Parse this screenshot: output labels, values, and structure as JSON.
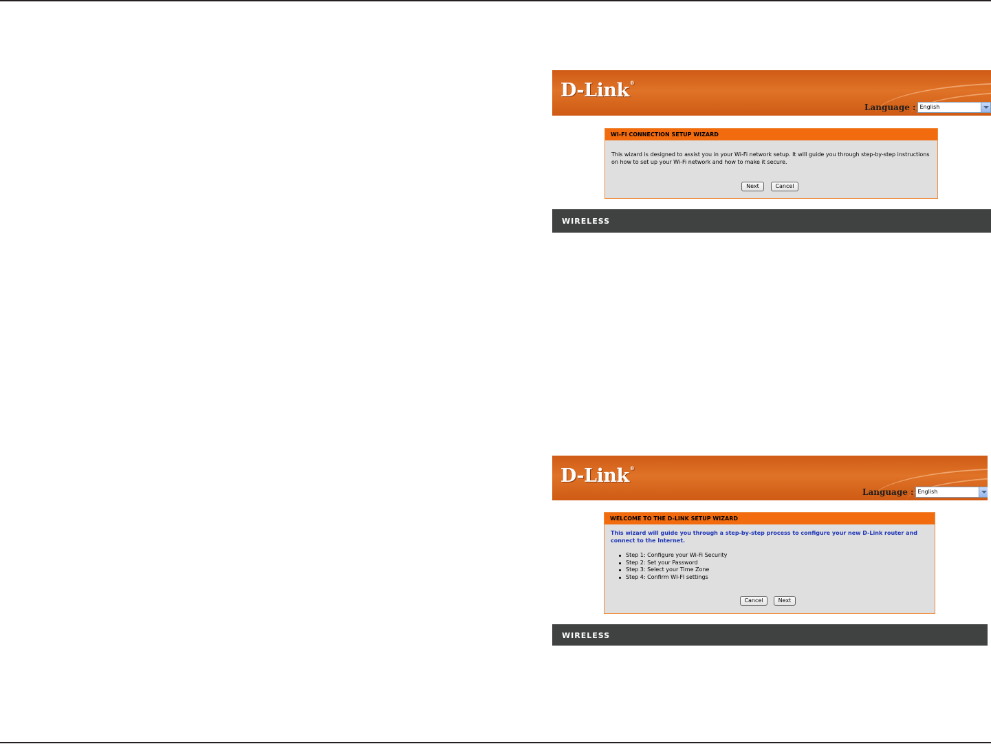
{
  "screenshots": [
    {
      "logo": "D-Link",
      "language_label": "Language :",
      "language_value": "English",
      "panel_title": "WI-FI CONNECTION SETUP WIZARD",
      "body_lines": [
        "This wizard is designed to assist you in your Wi-Fi network setup. It will guide you through step-by-step instructions",
        "on how to set up your Wi-Fi network and how to make it secure."
      ],
      "buttons": {
        "next": "Next",
        "cancel": "Cancel"
      },
      "footer": "WIRELESS"
    },
    {
      "logo": "D-Link",
      "language_label": "Language :",
      "language_value": "English",
      "panel_title": "WELCOME TO THE D-LINK SETUP WIZARD",
      "intro_lines": [
        "This wizard will guide you through a step-by-step process to configure your new D-Link router and",
        "connect to the Internet."
      ],
      "steps": [
        "Step 1: Configure your Wi-Fi Security",
        "Step 2: Set your Password",
        "Step 3: Select your Time Zone",
        "Step 4: Confirm WI-FI settings"
      ],
      "buttons": {
        "cancel": "Cancel",
        "next": "Next"
      },
      "footer": "WIRELESS"
    }
  ],
  "colors": {
    "banner_orange": "#df7327",
    "panel_header_orange": "#f26b0e",
    "panel_background": "#dfdfdf",
    "footer_bar": "#404242",
    "intro_text_blue": "#1d35b8"
  },
  "icons": [
    "dropdown-arrow-icon"
  ]
}
